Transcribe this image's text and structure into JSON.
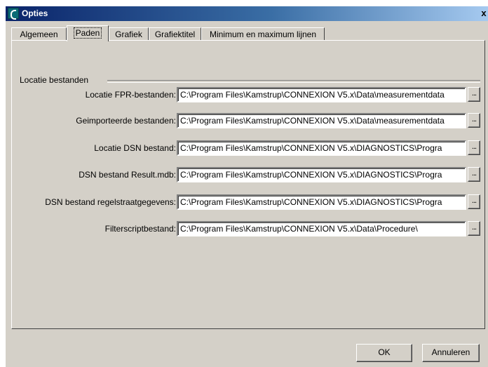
{
  "window": {
    "title": "Opties",
    "close_glyph": "x"
  },
  "tabs": [
    {
      "label": "Algemeen"
    },
    {
      "label": "Paden"
    },
    {
      "label": "Grafiek"
    },
    {
      "label": "Grafiektitel"
    },
    {
      "label": "Minimum en maximum lijnen"
    }
  ],
  "active_tab": "Paden",
  "group": {
    "label": "Locatie bestanden"
  },
  "rows": [
    {
      "label": "Locatie FPR-bestanden:",
      "value": "C:\\Program Files\\Kamstrup\\CONNEXION V5.x\\Data\\measurementdata",
      "browse": "..."
    },
    {
      "label": "Geimporteerde bestanden:",
      "value": "C:\\Program Files\\Kamstrup\\CONNEXION V5.x\\Data\\measurementdata",
      "browse": "..."
    },
    {
      "label": "Locatie DSN bestand:",
      "value": "C:\\Program Files\\Kamstrup\\CONNEXION V5.x\\DIAGNOSTICS\\Progra",
      "browse": "..."
    },
    {
      "label": "DSN bestand Result.mdb:",
      "value": "C:\\Program Files\\Kamstrup\\CONNEXION V5.x\\DIAGNOSTICS\\Progra",
      "browse": "..."
    },
    {
      "label": "DSN bestand regelstraatgegevens:",
      "value": "C:\\Program Files\\Kamstrup\\CONNEXION V5.x\\DIAGNOSTICS\\Progra",
      "browse": "..."
    },
    {
      "label": "Filterscriptbestand:",
      "value": "C:\\Program Files\\Kamstrup\\CONNEXION V5.x\\Data\\Procedure\\",
      "browse": "..."
    }
  ],
  "buttons": {
    "ok": "OK",
    "cancel": "Annuleren"
  },
  "colors": {
    "face": "#d4d0c8",
    "titlebar_start": "#0a246a",
    "titlebar_end": "#a6caf0"
  }
}
